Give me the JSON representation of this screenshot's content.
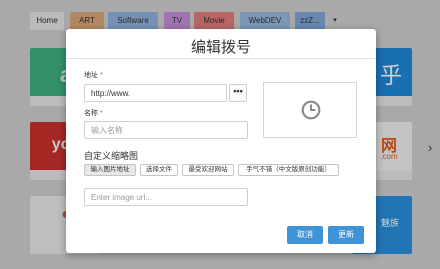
{
  "colors": {
    "primary_button": "#3f94d8",
    "required_mark": "#d9534f"
  },
  "tabs": [
    {
      "label": "Home",
      "color": "#e5e5e5"
    },
    {
      "label": "ART",
      "color": "#d9a778"
    },
    {
      "label": "Software",
      "color": "#8fb3dc"
    },
    {
      "label": "TV",
      "color": "#c48ed8"
    },
    {
      "label": "Movie",
      "color": "#e07c7c"
    },
    {
      "label": "WebDEV",
      "color": "#98b9de"
    },
    {
      "label": "zzZ...",
      "color": "#7fa6d9"
    }
  ],
  "background_tiles": {
    "right_top_glyph": "乎",
    "right_mid_glyph": "网",
    "right_mid_sub": ".com",
    "right_bottom_text": "魅族",
    "left_mid_glyph": "you"
  },
  "dialog": {
    "title": "编辑拨号",
    "url_label": "地址",
    "url_value": "http://www.",
    "url_button_icon": "more-icon",
    "url_button_text": "•••",
    "name_label": "名称",
    "name_placeholder": "输入名称",
    "preview_icon": "clock-icon",
    "thumbnail_section": "自定义缩略图",
    "thumbnail_options": [
      {
        "label": "输入图片地址",
        "active": true
      },
      {
        "label": "选择文件",
        "active": false
      },
      {
        "label": "最受欢迎网站",
        "active": false
      },
      {
        "label": "手气不错（中文版原创功能）",
        "active": false
      }
    ],
    "image_url_placeholder": "Enter image url...",
    "cancel_label": "取消",
    "update_label": "更新"
  }
}
